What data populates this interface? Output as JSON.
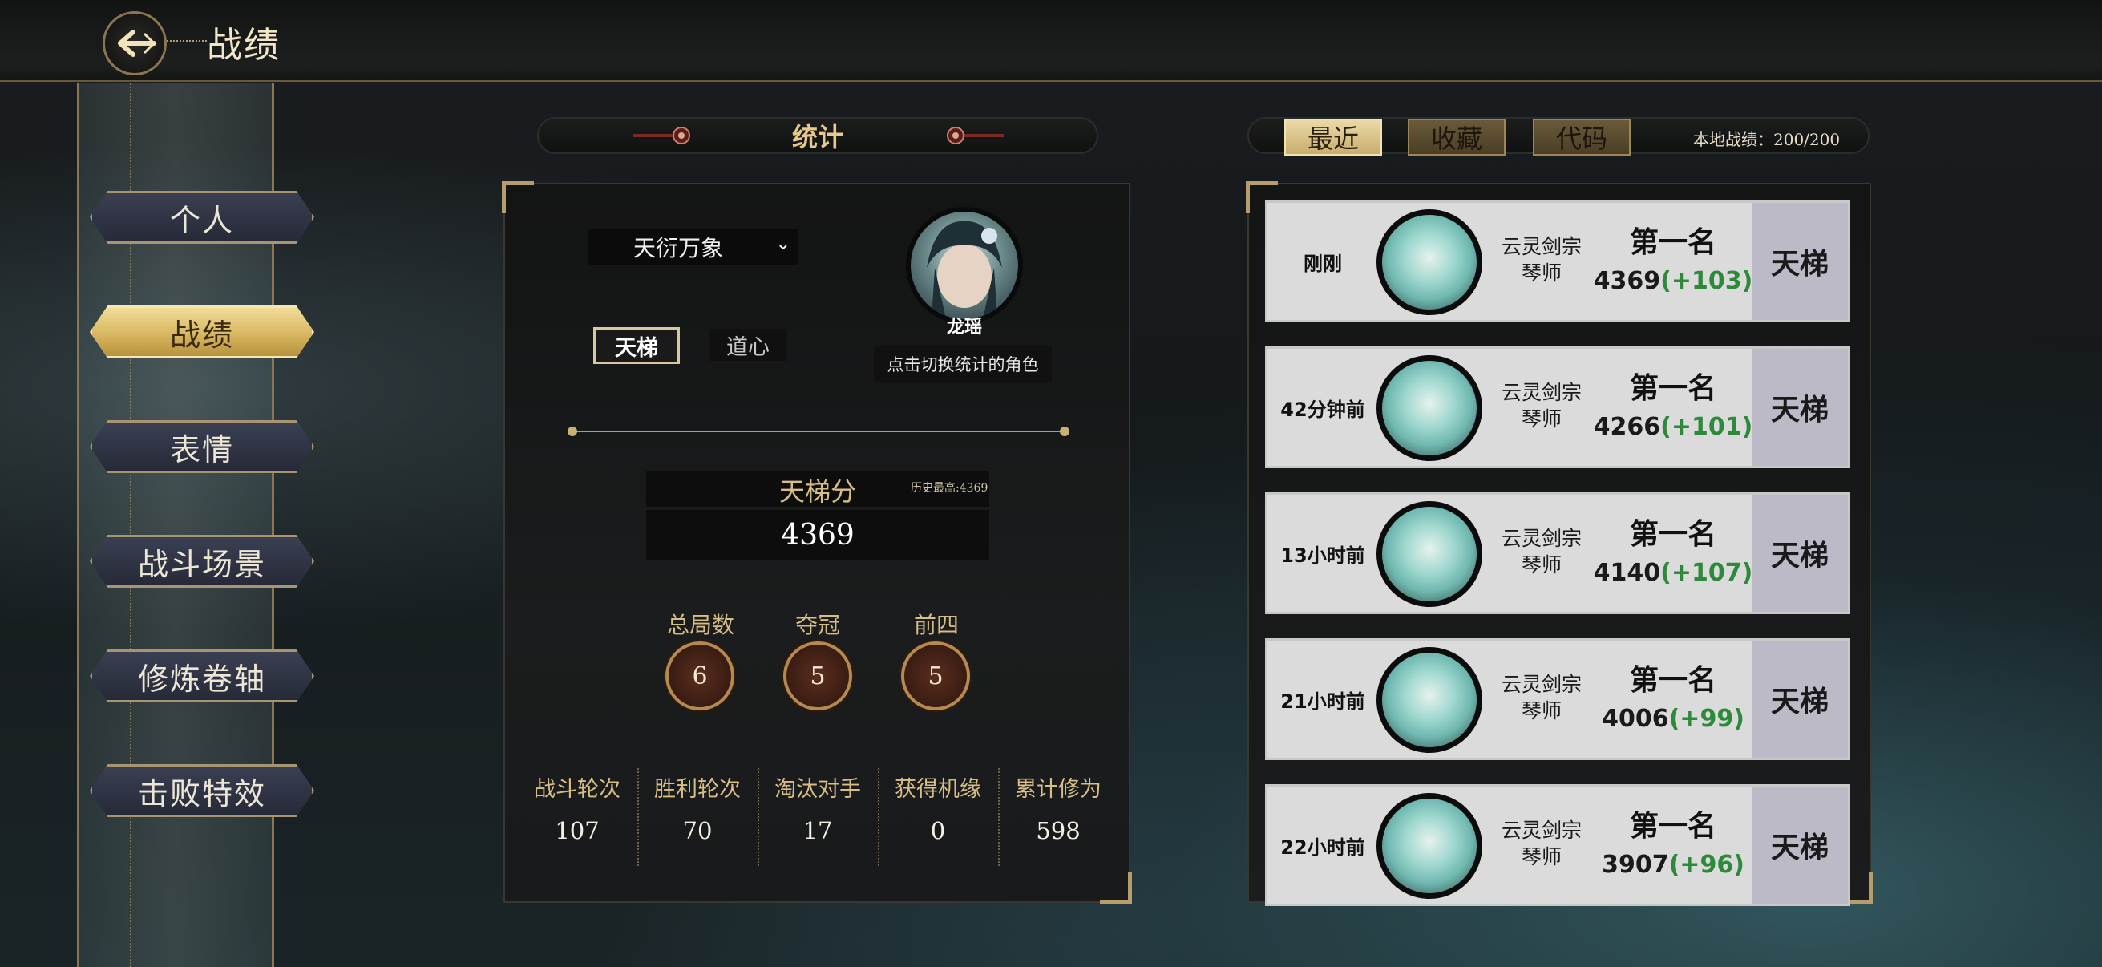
{
  "header": {
    "title": "战绩"
  },
  "nav": {
    "items": [
      {
        "label": "个人",
        "active": false
      },
      {
        "label": "战绩",
        "active": true
      },
      {
        "label": "表情",
        "active": false
      },
      {
        "label": "战斗场景",
        "active": false
      },
      {
        "label": "修炼卷轴",
        "active": false
      },
      {
        "label": "击败特效",
        "active": false
      }
    ]
  },
  "stats": {
    "title": "统计",
    "mode_select": "天衍万象",
    "character": {
      "name": "龙瑶",
      "hint": "点击切换统计的角色"
    },
    "tabs": [
      {
        "label": "天梯",
        "active": true
      },
      {
        "label": "道心",
        "active": false
      }
    ],
    "ladder_score": {
      "label": "天梯分",
      "value": "4369",
      "history_high": "历史最高:4369"
    },
    "summary": [
      {
        "label": "总局数",
        "value": "6"
      },
      {
        "label": "夺冠",
        "value": "5"
      },
      {
        "label": "前四",
        "value": "5"
      }
    ],
    "details": [
      {
        "label": "战斗轮次",
        "value": "107"
      },
      {
        "label": "胜利轮次",
        "value": "70"
      },
      {
        "label": "淘汰对手",
        "value": "17"
      },
      {
        "label": "获得机缘",
        "value": "0"
      },
      {
        "label": "累计修为",
        "value": "598"
      }
    ]
  },
  "records": {
    "tabs": [
      {
        "label": "最近",
        "active": true
      },
      {
        "label": "收藏",
        "active": false
      },
      {
        "label": "代码",
        "active": false
      }
    ],
    "local_count": "本地战绩：200/200",
    "items": [
      {
        "time": "刚刚",
        "sect": "云灵剑宗",
        "role": "琴师",
        "rank": "第一名",
        "score": "4369",
        "delta": "(+103)",
        "mode": "天梯"
      },
      {
        "time": "42分钟前",
        "sect": "云灵剑宗",
        "role": "琴师",
        "rank": "第一名",
        "score": "4266",
        "delta": "(+101)",
        "mode": "天梯"
      },
      {
        "time": "13小时前",
        "sect": "云灵剑宗",
        "role": "琴师",
        "rank": "第一名",
        "score": "4140",
        "delta": "(+107)",
        "mode": "天梯"
      },
      {
        "time": "21小时前",
        "sect": "云灵剑宗",
        "role": "琴师",
        "rank": "第一名",
        "score": "4006",
        "delta": "(+99)",
        "mode": "天梯"
      },
      {
        "time": "22小时前",
        "sect": "云灵剑宗",
        "role": "琴师",
        "rank": "第一名",
        "score": "3907",
        "delta": "(+96)",
        "mode": "天梯"
      }
    ]
  },
  "colors": {
    "gold_accent": "#b59e6b",
    "active_gold": "#d8b760",
    "delta_green": "#2d8a3a"
  }
}
